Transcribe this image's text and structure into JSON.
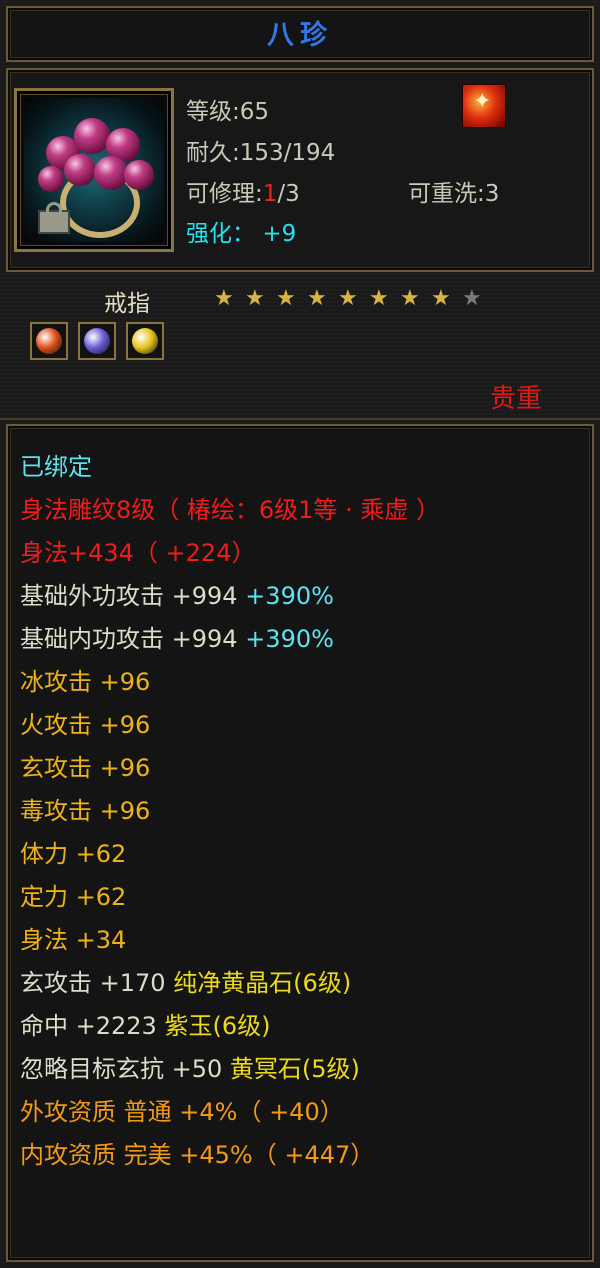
{
  "title": "八珍",
  "item": {
    "level_label": "等级",
    "level": ":65",
    "durability_label": "耐久",
    "durability": ":153/194",
    "repair_label": "可修理",
    "repair_colon": ":",
    "repair_used": "1",
    "repair_max": "/3",
    "rewash_label": "可重洗",
    "rewash": ":3",
    "enhance_label": "强化：",
    "enhance": "+9",
    "badge_icon": "flame-emblem-icon",
    "type": "戒指",
    "stars_filled": 8,
    "stars_total": 9,
    "rarity": "贵重",
    "gems": [
      {
        "name": "red-gem-icon",
        "color": "#e0501a"
      },
      {
        "name": "purple-gem-icon",
        "color": "#6a5cd8"
      },
      {
        "name": "yellow-gem-icon",
        "color": "#e8c41a"
      }
    ]
  },
  "attributes": [
    {
      "parts": [
        {
          "t": "已绑定",
          "c": "cyan"
        }
      ]
    },
    {
      "parts": [
        {
          "t": "身法雕纹8级（ 椿绘：6级1等 · 乘虚 ）",
          "c": "red"
        }
      ]
    },
    {
      "parts": [
        {
          "t": "身法+434（ +224）",
          "c": "red"
        }
      ]
    },
    {
      "parts": [
        {
          "t": "基础外功攻击 +994 ",
          "c": "white"
        },
        {
          "t": "+390%",
          "c": "cyan"
        }
      ]
    },
    {
      "parts": [
        {
          "t": "基础内功攻击 +994 ",
          "c": "white"
        },
        {
          "t": "+390%",
          "c": "cyan"
        }
      ]
    },
    {
      "parts": [
        {
          "t": "冰攻击 +96",
          "c": "gold"
        }
      ]
    },
    {
      "parts": [
        {
          "t": "火攻击 +96",
          "c": "gold"
        }
      ]
    },
    {
      "parts": [
        {
          "t": "玄攻击 +96",
          "c": "gold"
        }
      ]
    },
    {
      "parts": [
        {
          "t": "毒攻击 +96",
          "c": "gold"
        }
      ]
    },
    {
      "parts": [
        {
          "t": "体力 +62",
          "c": "gold"
        }
      ]
    },
    {
      "parts": [
        {
          "t": "定力 +62",
          "c": "gold"
        }
      ]
    },
    {
      "parts": [
        {
          "t": "身法 +34",
          "c": "gold"
        }
      ]
    },
    {
      "parts": [
        {
          "t": "玄攻击 +170 ",
          "c": "white"
        },
        {
          "t": "纯净黄晶石(6级)",
          "c": "yellow"
        }
      ]
    },
    {
      "parts": [
        {
          "t": "命中 +2223 ",
          "c": "white"
        },
        {
          "t": "紫玉(6级)",
          "c": "yellow"
        }
      ]
    },
    {
      "parts": [
        {
          "t": "忽略目标玄抗 +50 ",
          "c": "white"
        },
        {
          "t": "黄冥石(5级)",
          "c": "yellow"
        }
      ]
    },
    {
      "parts": [
        {
          "t": "外攻资质 普通 +4%（ +40）",
          "c": "orange"
        }
      ]
    },
    {
      "parts": [
        {
          "t": "内攻资质 完美 +45%（ +447）",
          "c": "orange"
        }
      ]
    }
  ]
}
